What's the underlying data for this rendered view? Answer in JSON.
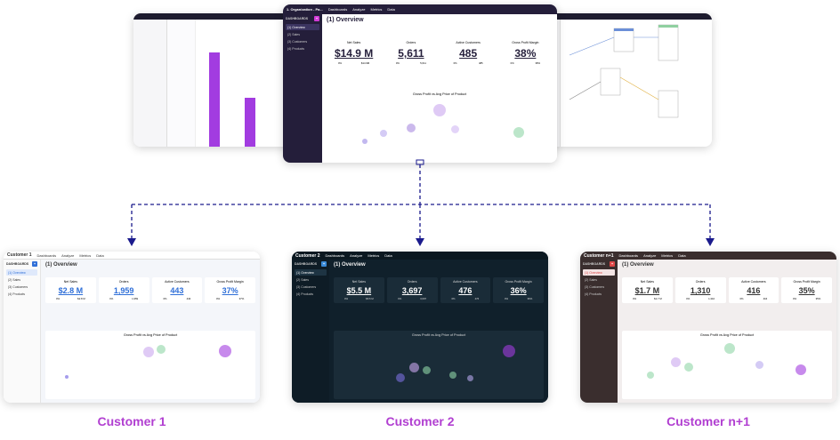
{
  "captions": [
    "Customer 1",
    "Customer 2",
    "Customer n+1"
  ],
  "top_window": {
    "app_title": "1. Organization - Pa...",
    "menu": [
      "Dashboards",
      "Analyze",
      "Metrics",
      "Data"
    ],
    "sidebar_header": "DASHBOARDS",
    "sidebar_items": [
      "(1) Overview",
      "(2) Sales",
      "(3) Customers",
      "(4) Products"
    ],
    "page_title": "(1) Overview",
    "kpis": [
      {
        "label": "Net Sales",
        "value": "$14.9 M",
        "pct": "0%",
        "prev": "$14.9M"
      },
      {
        "label": "Orders",
        "value": "5,611",
        "pct": "0%",
        "prev": "5,611"
      },
      {
        "label": "Active Customers",
        "value": "485",
        "pct": "0%",
        "prev": "485"
      },
      {
        "label": "Gross Profit Margin",
        "value": "38%",
        "pct": "0%",
        "prev": "38%"
      }
    ],
    "plot_title": "Gross Profit vs Avg Price of Product"
  },
  "customer1": {
    "app_title": "Customer 1",
    "menu": [
      "Dashboards",
      "Analyze",
      "Metrics",
      "Data"
    ],
    "sidebar_header": "DASHBOARDS",
    "sidebar_items": [
      "(1) Overview",
      "(2) Sales",
      "(3) Customers",
      "(4) Products"
    ],
    "page_title": "(1) Overview",
    "kpis": [
      {
        "label": "Net Sales",
        "value": "$2.8 M",
        "pct": "0%",
        "prev": "$2.8 M"
      },
      {
        "label": "Orders",
        "value": "1,959",
        "pct": "0%",
        "prev": "1,959"
      },
      {
        "label": "Active Customers",
        "value": "443",
        "pct": "0%",
        "prev": "443"
      },
      {
        "label": "Gross Profit Margin",
        "value": "37%",
        "pct": "0%",
        "prev": "37%"
      }
    ],
    "plot_title": "Gross Profit vs Avg Price of Product"
  },
  "customer2": {
    "app_title": "Customer 2",
    "menu": [
      "Dashboards",
      "Analyze",
      "Metrics",
      "Data"
    ],
    "sidebar_header": "DASHBOARDS",
    "sidebar_items": [
      "(1) Overview",
      "(2) Sales",
      "(3) Customers",
      "(4) Products"
    ],
    "page_title": "(1) Overview",
    "kpis": [
      {
        "label": "Net Sales",
        "value": "$5.5 M",
        "pct": "0%",
        "prev": "$5.5 M"
      },
      {
        "label": "Orders",
        "value": "3,697",
        "pct": "0%",
        "prev": "3,697"
      },
      {
        "label": "Active Customers",
        "value": "476",
        "pct": "0%",
        "prev": "476"
      },
      {
        "label": "Gross Profit Margin",
        "value": "36%",
        "pct": "0%",
        "prev": "36%"
      }
    ],
    "plot_title": "Gross Profit vs Avg Price of Product"
  },
  "customer3": {
    "app_title": "Customer n+1",
    "menu": [
      "Dashboards",
      "Analyze",
      "Metrics",
      "Data"
    ],
    "sidebar_header": "DASHBOARDS",
    "sidebar_items": [
      "(1) Overview",
      "(2) Sales",
      "(3) Customers",
      "(4) Products"
    ],
    "page_title": "(1) Overview",
    "kpis": [
      {
        "label": "Net Sales",
        "value": "$1.7 M",
        "pct": "0%",
        "prev": "$1.7 M"
      },
      {
        "label": "Orders",
        "value": "1,310",
        "pct": "0%",
        "prev": "1,310"
      },
      {
        "label": "Active Customers",
        "value": "416",
        "pct": "0%",
        "prev": "416"
      },
      {
        "label": "Gross Profit Margin",
        "value": "35%",
        "pct": "0%",
        "prev": "35%"
      }
    ],
    "plot_title": "Gross Profit vs Avg Price of Product"
  },
  "colors": {
    "caption": "#b13fd1",
    "arrow": "#1a1a8c",
    "purple_accent": "#a23ce0",
    "customer1_accent": "#2f6fd8",
    "customer2_bg": "#10202b",
    "customer3_accent": "#e04848"
  }
}
